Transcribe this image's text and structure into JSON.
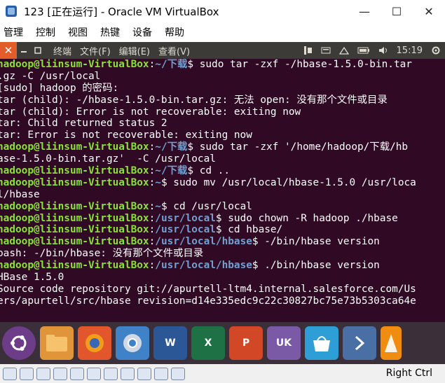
{
  "window": {
    "title": "123 [正在运行] - Oracle VM VirtualBox",
    "minimize": "—",
    "maximize": "☐",
    "close": "✕"
  },
  "vm_menu": [
    "管理",
    "控制",
    "视图",
    "热键",
    "设备",
    "帮助"
  ],
  "ubuntu_panel": {
    "menus": [
      "终端",
      "文件(F)",
      "编辑(E)",
      "查看(V)"
    ],
    "clock": "15:19"
  },
  "terminal": {
    "lines": [
      [
        [
          "u",
          "hadoop@liinsum-VirtualBox"
        ],
        [
          "t",
          ":"
        ],
        [
          "p",
          "~/下载"
        ],
        [
          "t",
          "$ sudo tar -zxf -/hbase-1.5.0-bin.tar"
        ]
      ],
      [
        [
          "t",
          ".gz -C /usr/local"
        ]
      ],
      [
        [
          "t",
          "[sudo] hadoop 的密码:"
        ]
      ],
      [
        [
          "t",
          "tar (child): -/hbase-1.5.0-bin.tar.gz: 无法 open: 没有那个文件或目录"
        ]
      ],
      [
        [
          "t",
          "tar (child): Error is not recoverable: exiting now"
        ]
      ],
      [
        [
          "t",
          "tar: Child returned status 2"
        ]
      ],
      [
        [
          "t",
          "tar: Error is not recoverable: exiting now"
        ]
      ],
      [
        [
          "u",
          "hadoop@liinsum-VirtualBox"
        ],
        [
          "t",
          ":"
        ],
        [
          "p",
          "~/下载"
        ],
        [
          "t",
          "$ sudo tar -zxf '/home/hadoop/下载/hb"
        ]
      ],
      [
        [
          "t",
          "ase-1.5.0-bin.tar.gz'  -C /usr/local"
        ]
      ],
      [
        [
          "u",
          "hadoop@liinsum-VirtualBox"
        ],
        [
          "t",
          ":"
        ],
        [
          "p",
          "~/下载"
        ],
        [
          "t",
          "$ cd .."
        ]
      ],
      [
        [
          "u",
          "hadoop@liinsum-VirtualBox"
        ],
        [
          "t",
          ":"
        ],
        [
          "p",
          "~"
        ],
        [
          "t",
          "$ sudo mv /usr/local/hbase-1.5.0 /usr/loca"
        ]
      ],
      [
        [
          "t",
          "l/hbase"
        ]
      ],
      [
        [
          "u",
          "hadoop@liinsum-VirtualBox"
        ],
        [
          "t",
          ":"
        ],
        [
          "p",
          "~"
        ],
        [
          "t",
          "$ cd /usr/local"
        ]
      ],
      [
        [
          "u",
          "hadoop@liinsum-VirtualBox"
        ],
        [
          "t",
          ":"
        ],
        [
          "p",
          "/usr/local"
        ],
        [
          "t",
          "$ sudo chown -R hadoop ./hbase"
        ]
      ],
      [
        [
          "u",
          "hadoop@liinsum-VirtualBox"
        ],
        [
          "t",
          ":"
        ],
        [
          "p",
          "/usr/local"
        ],
        [
          "t",
          "$ cd hbase/"
        ]
      ],
      [
        [
          "u",
          "hadoop@liinsum-VirtualBox"
        ],
        [
          "t",
          ":"
        ],
        [
          "p",
          "/usr/local/hbase"
        ],
        [
          "t",
          "$ -/bin/hbase version"
        ]
      ],
      [
        [
          "t",
          "bash: -/bin/hbase: 没有那个文件或目录"
        ]
      ],
      [
        [
          "u",
          "hadoop@liinsum-VirtualBox"
        ],
        [
          "t",
          ":"
        ],
        [
          "p",
          "/usr/local/hbase"
        ],
        [
          "t",
          "$ ./bin/hbase version"
        ]
      ],
      [
        [
          "t",
          "HBase 1.5.0"
        ]
      ],
      [
        [
          "t",
          "Source code repository git://apurtell-ltm4.internal.salesforce.com/Us"
        ]
      ],
      [
        [
          "t",
          "ers/apurtell/src/hbase revision=d14e335edc9c22c30827bc75e73b5303ca64e"
        ]
      ]
    ]
  },
  "dock": {
    "icons": [
      "ubuntu-icon",
      "files-icon",
      "firefox-icon",
      "chromium-icon",
      "word-icon",
      "excel-icon",
      "powerpoint-icon",
      "uk-bag-icon",
      "software-center-icon",
      "next-arrow-icon",
      "vlc-icon"
    ],
    "colors": {
      "ubuntu": "#6e3d8a",
      "files": "#e0953a",
      "firefox": "#e1562a",
      "chromium": "#3f82c8",
      "word": "#2b5797",
      "excel": "#1e7145",
      "powerpoint": "#d24726",
      "uk": "#7a5aa6",
      "software": "#2e9fd6",
      "next": "#4a6fa5",
      "vlc": "#f08c10"
    },
    "labels": {
      "word": "W",
      "excel": "X",
      "powerpoint": "P",
      "uk": "UK"
    }
  },
  "statusbar": {
    "right_ctrl": "Right Ctrl"
  }
}
